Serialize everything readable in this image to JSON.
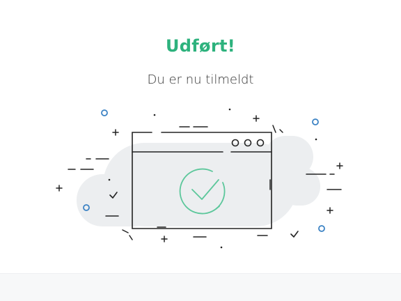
{
  "success": {
    "title": "Udført!",
    "message": "Du er nu tilmeldt"
  },
  "illustration": {
    "icon": "browser-window-checkmark-icon"
  },
  "colors": {
    "accent": "#2db27d",
    "accent_light": "#5cc79b",
    "stroke": "#222222",
    "cloud": "#eceef0",
    "blue": "#3b82c4"
  }
}
